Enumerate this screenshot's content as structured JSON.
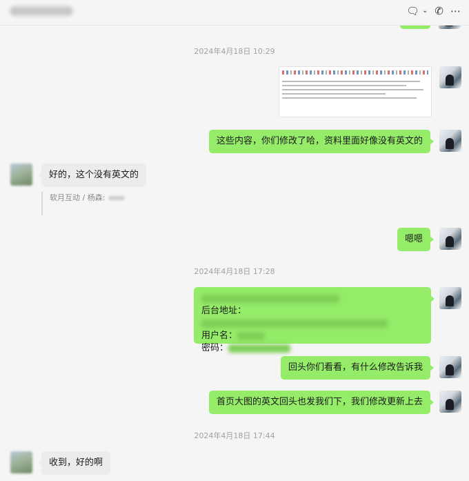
{
  "header": {
    "icons": [
      "chat-bubble-icon",
      "chevron-down-icon",
      "phone-icon",
      "more-icon"
    ]
  },
  "messages": {
    "ts1": "2024年4月18日 10:29",
    "m1": "这些内容，你们修改了哈，资料里面好像没有英文的",
    "m2": "好的，这个没有英文的",
    "quote": "软月互动 / 杨森:",
    "m3": "嗯嗯",
    "ts2": "2024年4月18日 17:28",
    "m4_l1": "后台地址：",
    "m4_l2": "用户名：",
    "m4_l3": "密码：",
    "m5": "回头你们看看，有什么修改告诉我",
    "m6": "首页大图的英文回头也发我们下，我们修改更新上去",
    "ts3": "2024年4月18日 17:44",
    "m7": "收到，好的啊"
  },
  "colors": {
    "self_bubble": "#95ec69",
    "other_bubble": "#ececec",
    "background": "#f5f5f5"
  }
}
